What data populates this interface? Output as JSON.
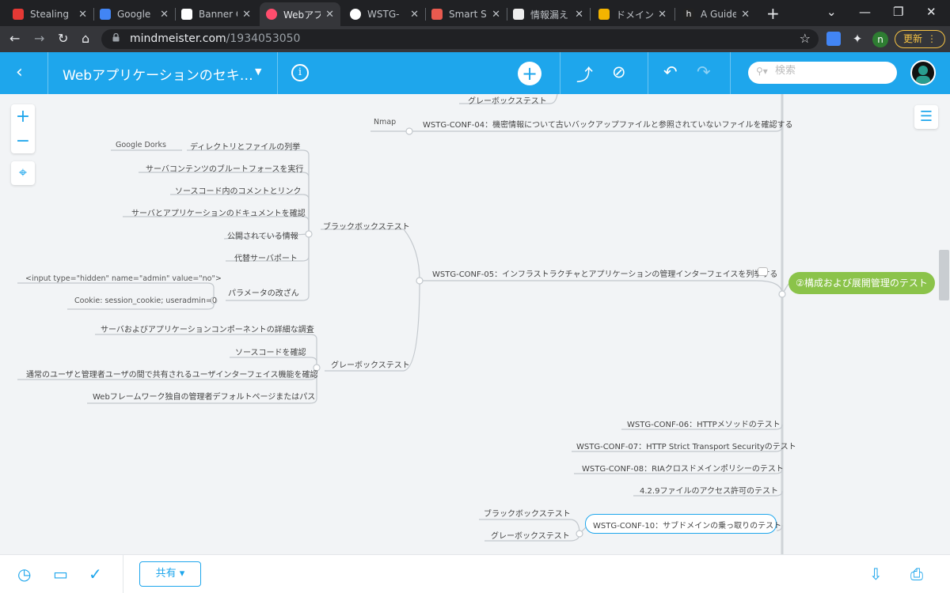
{
  "browser": {
    "tabs": [
      {
        "title": "Stealing",
        "fav_color": "#e53935"
      },
      {
        "title": "Google",
        "fav_color": "#4285f4"
      },
      {
        "title": "Banner G",
        "fav_color": "#ffffff"
      },
      {
        "title": "Webアプリ",
        "fav_color": "#ff4d6d"
      },
      {
        "title": "WSTG-",
        "fav_color": "#ffffff"
      },
      {
        "title": "Smart Se",
        "fav_color": "#e85a4f"
      },
      {
        "title": "情報漏え",
        "fav_color": "#eeeeee"
      },
      {
        "title": "ドメインで",
        "fav_color": "#f4b400"
      },
      {
        "title": "A Guide",
        "fav_color": "#222222"
      }
    ],
    "url_host": "mindmeister.com",
    "url_path": "/1934053050",
    "profile_initial": "n",
    "update_label": "更新"
  },
  "app": {
    "title": "Webアプリケーションのセキ…",
    "search_placeholder": "検索",
    "accent": "#1ea6ec",
    "share_label": "共有"
  },
  "mindmap": {
    "root": "②構成および展開管理のテスト",
    "root_color": "#8bc34a",
    "nodes": [
      {
        "id": "gbt-top",
        "text": "グレーボックステスト"
      },
      {
        "id": "nmap",
        "text": "Nmap"
      },
      {
        "id": "conf04",
        "text": "WSTG-CONF-04：機密情報について古いバックアップファイルと参照されていないファイルを確認する"
      },
      {
        "id": "google-dorks",
        "text": "Google Dorks"
      },
      {
        "id": "dir-enum",
        "text": "ディレクトリとファイルの列挙"
      },
      {
        "id": "brute",
        "text": "サーバコンテンツのブルートフォースを実行"
      },
      {
        "id": "comments",
        "text": "ソースコード内のコメントとリンク"
      },
      {
        "id": "docs",
        "text": "サーバとアプリケーションのドキュメントを確認"
      },
      {
        "id": "public-info",
        "text": "公開されている情報"
      },
      {
        "id": "alt-port",
        "text": "代替サーバポート"
      },
      {
        "id": "hidden-input",
        "text": "<input type=\"hidden\" name=\"admin\" value=\"no\">"
      },
      {
        "id": "cookie",
        "text": "Cookie: session_cookie; useradmin=0"
      },
      {
        "id": "param-tamper",
        "text": "パラメータの改ざん"
      },
      {
        "id": "bbt",
        "text": "ブラックボックステスト"
      },
      {
        "id": "conf05",
        "text": "WSTG-CONF-05：インフラストラクチャとアプリケーションの管理インターフェイスを列挙する"
      },
      {
        "id": "component-review",
        "text": "サーバおよびアプリケーションコンポーネントの詳細な調査"
      },
      {
        "id": "source-check",
        "text": "ソースコードを確認"
      },
      {
        "id": "shared-ui",
        "text": "通常のユーザと管理者ユーザの間で共有されるユーザインターフェイス機能を確認"
      },
      {
        "id": "gbt-mid",
        "text": "グレーボックステスト"
      },
      {
        "id": "fw-default",
        "text": "Webフレームワーク独自の管理者デフォルトページまたはパス"
      },
      {
        "id": "conf06",
        "text": "WSTG-CONF-06：HTTPメソッドのテスト"
      },
      {
        "id": "conf07",
        "text": "WSTG-CONF-07：HTTP Strict Transport Securityのテスト"
      },
      {
        "id": "conf08",
        "text": "WSTG-CONF-08：RIAクロスドメインポリシーのテスト"
      },
      {
        "id": "perm429",
        "text": "4.2.9ファイルのアクセス許可のテスト"
      },
      {
        "id": "bbt-low",
        "text": "ブラックボックステスト"
      },
      {
        "id": "gbt-low",
        "text": "グレーボックステスト"
      },
      {
        "id": "conf10",
        "text": "WSTG-CONF-10：サブドメインの乗っ取りのテスト"
      }
    ]
  }
}
